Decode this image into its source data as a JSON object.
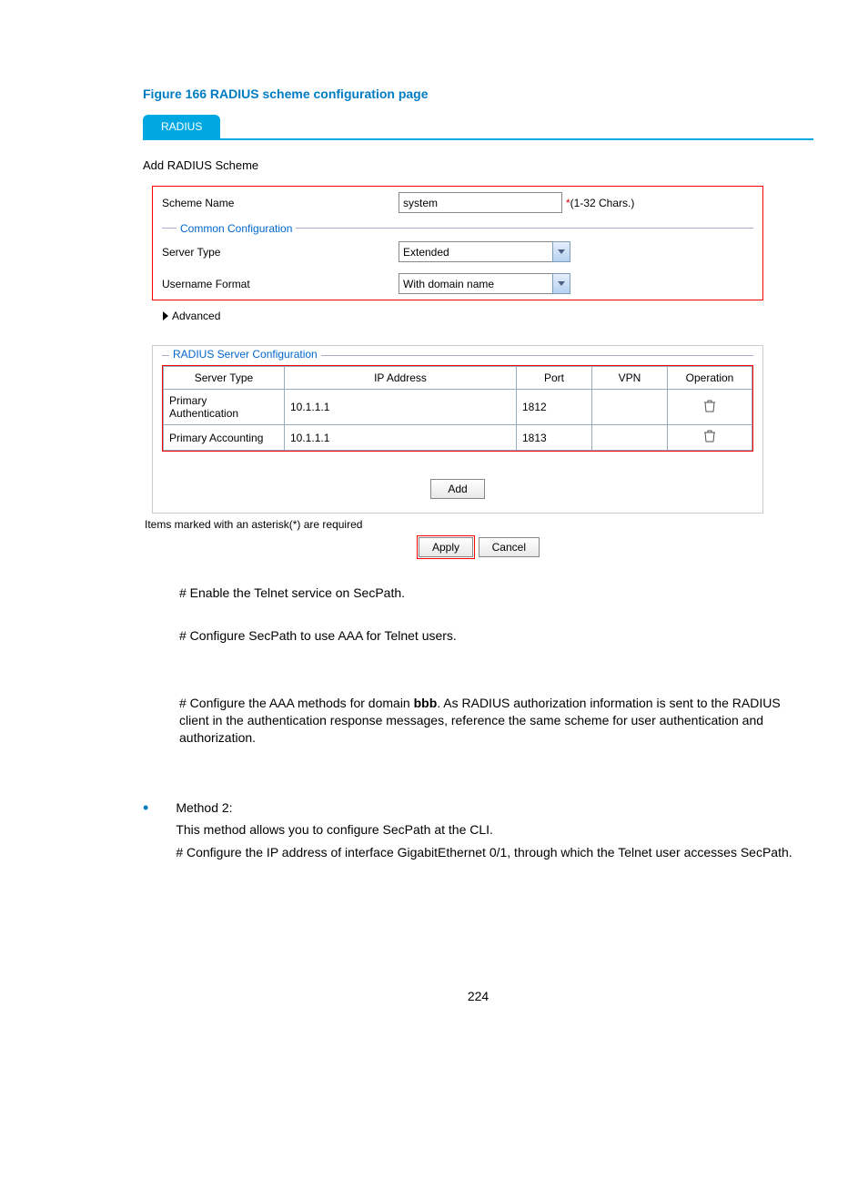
{
  "figure_title": "Figure 166 RADIUS scheme configuration page",
  "tab_label": "RADIUS",
  "section_heading": "Add RADIUS Scheme",
  "scheme": {
    "name_label": "Scheme Name",
    "name_value": "system",
    "name_hint": "(1-32 Chars.)",
    "asterisk": "*"
  },
  "common_config": {
    "legend": "Common Configuration",
    "server_type_label": "Server Type",
    "server_type_value": "Extended",
    "username_format_label": "Username Format",
    "username_format_value": "With domain name"
  },
  "advanced_label": "Advanced",
  "radius_server": {
    "legend": "RADIUS Server Configuration",
    "headers": {
      "server_type": "Server Type",
      "ip": "IP Address",
      "port": "Port",
      "vpn": "VPN",
      "operation": "Operation"
    },
    "rows": [
      {
        "type": "Primary Authentication",
        "ip": "10.1.1.1",
        "port": "1812",
        "vpn": ""
      },
      {
        "type": "Primary Accounting",
        "ip": "10.1.1.1",
        "port": "1813",
        "vpn": ""
      }
    ]
  },
  "add_btn": "Add",
  "required_note": "Items marked with an asterisk(*) are required",
  "apply_btn": "Apply",
  "cancel_btn": "Cancel",
  "body": {
    "p1": "# Enable the Telnet service on SecPath.",
    "p2": "# Configure SecPath to use AAA for Telnet users.",
    "p3a": "# Configure the AAA methods for domain ",
    "p3b": "bbb",
    "p3c": ". As RADIUS authorization information is sent to the RADIUS client in the authentication response messages, reference the same scheme for user authentication and authorization.",
    "method2_label": "Method 2:",
    "method2_desc": "This method allows you to configure SecPath at the CLI.",
    "method2_step": "# Configure the IP address of interface GigabitEthernet 0/1, through which the Telnet user accesses SecPath."
  },
  "page_number": "224"
}
